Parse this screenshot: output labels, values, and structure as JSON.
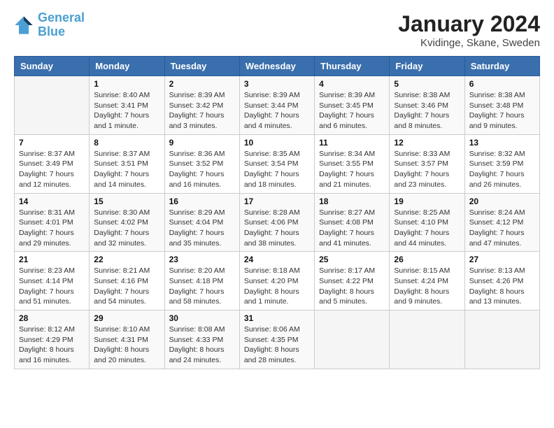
{
  "logo": {
    "line1": "General",
    "line2": "Blue"
  },
  "title": "January 2024",
  "location": "Kvidinge, Skane, Sweden",
  "days_of_week": [
    "Sunday",
    "Monday",
    "Tuesday",
    "Wednesday",
    "Thursday",
    "Friday",
    "Saturday"
  ],
  "weeks": [
    [
      {
        "day": "",
        "info": ""
      },
      {
        "day": "1",
        "info": "Sunrise: 8:40 AM\nSunset: 3:41 PM\nDaylight: 7 hours\nand 1 minute."
      },
      {
        "day": "2",
        "info": "Sunrise: 8:39 AM\nSunset: 3:42 PM\nDaylight: 7 hours\nand 3 minutes."
      },
      {
        "day": "3",
        "info": "Sunrise: 8:39 AM\nSunset: 3:44 PM\nDaylight: 7 hours\nand 4 minutes."
      },
      {
        "day": "4",
        "info": "Sunrise: 8:39 AM\nSunset: 3:45 PM\nDaylight: 7 hours\nand 6 minutes."
      },
      {
        "day": "5",
        "info": "Sunrise: 8:38 AM\nSunset: 3:46 PM\nDaylight: 7 hours\nand 8 minutes."
      },
      {
        "day": "6",
        "info": "Sunrise: 8:38 AM\nSunset: 3:48 PM\nDaylight: 7 hours\nand 9 minutes."
      }
    ],
    [
      {
        "day": "7",
        "info": "Sunrise: 8:37 AM\nSunset: 3:49 PM\nDaylight: 7 hours\nand 12 minutes."
      },
      {
        "day": "8",
        "info": "Sunrise: 8:37 AM\nSunset: 3:51 PM\nDaylight: 7 hours\nand 14 minutes."
      },
      {
        "day": "9",
        "info": "Sunrise: 8:36 AM\nSunset: 3:52 PM\nDaylight: 7 hours\nand 16 minutes."
      },
      {
        "day": "10",
        "info": "Sunrise: 8:35 AM\nSunset: 3:54 PM\nDaylight: 7 hours\nand 18 minutes."
      },
      {
        "day": "11",
        "info": "Sunrise: 8:34 AM\nSunset: 3:55 PM\nDaylight: 7 hours\nand 21 minutes."
      },
      {
        "day": "12",
        "info": "Sunrise: 8:33 AM\nSunset: 3:57 PM\nDaylight: 7 hours\nand 23 minutes."
      },
      {
        "day": "13",
        "info": "Sunrise: 8:32 AM\nSunset: 3:59 PM\nDaylight: 7 hours\nand 26 minutes."
      }
    ],
    [
      {
        "day": "14",
        "info": "Sunrise: 8:31 AM\nSunset: 4:01 PM\nDaylight: 7 hours\nand 29 minutes."
      },
      {
        "day": "15",
        "info": "Sunrise: 8:30 AM\nSunset: 4:02 PM\nDaylight: 7 hours\nand 32 minutes."
      },
      {
        "day": "16",
        "info": "Sunrise: 8:29 AM\nSunset: 4:04 PM\nDaylight: 7 hours\nand 35 minutes."
      },
      {
        "day": "17",
        "info": "Sunrise: 8:28 AM\nSunset: 4:06 PM\nDaylight: 7 hours\nand 38 minutes."
      },
      {
        "day": "18",
        "info": "Sunrise: 8:27 AM\nSunset: 4:08 PM\nDaylight: 7 hours\nand 41 minutes."
      },
      {
        "day": "19",
        "info": "Sunrise: 8:25 AM\nSunset: 4:10 PM\nDaylight: 7 hours\nand 44 minutes."
      },
      {
        "day": "20",
        "info": "Sunrise: 8:24 AM\nSunset: 4:12 PM\nDaylight: 7 hours\nand 47 minutes."
      }
    ],
    [
      {
        "day": "21",
        "info": "Sunrise: 8:23 AM\nSunset: 4:14 PM\nDaylight: 7 hours\nand 51 minutes."
      },
      {
        "day": "22",
        "info": "Sunrise: 8:21 AM\nSunset: 4:16 PM\nDaylight: 7 hours\nand 54 minutes."
      },
      {
        "day": "23",
        "info": "Sunrise: 8:20 AM\nSunset: 4:18 PM\nDaylight: 7 hours\nand 58 minutes."
      },
      {
        "day": "24",
        "info": "Sunrise: 8:18 AM\nSunset: 4:20 PM\nDaylight: 8 hours\nand 1 minute."
      },
      {
        "day": "25",
        "info": "Sunrise: 8:17 AM\nSunset: 4:22 PM\nDaylight: 8 hours\nand 5 minutes."
      },
      {
        "day": "26",
        "info": "Sunrise: 8:15 AM\nSunset: 4:24 PM\nDaylight: 8 hours\nand 9 minutes."
      },
      {
        "day": "27",
        "info": "Sunrise: 8:13 AM\nSunset: 4:26 PM\nDaylight: 8 hours\nand 13 minutes."
      }
    ],
    [
      {
        "day": "28",
        "info": "Sunrise: 8:12 AM\nSunset: 4:29 PM\nDaylight: 8 hours\nand 16 minutes."
      },
      {
        "day": "29",
        "info": "Sunrise: 8:10 AM\nSunset: 4:31 PM\nDaylight: 8 hours\nand 20 minutes."
      },
      {
        "day": "30",
        "info": "Sunrise: 8:08 AM\nSunset: 4:33 PM\nDaylight: 8 hours\nand 24 minutes."
      },
      {
        "day": "31",
        "info": "Sunrise: 8:06 AM\nSunset: 4:35 PM\nDaylight: 8 hours\nand 28 minutes."
      },
      {
        "day": "",
        "info": ""
      },
      {
        "day": "",
        "info": ""
      },
      {
        "day": "",
        "info": ""
      }
    ]
  ]
}
